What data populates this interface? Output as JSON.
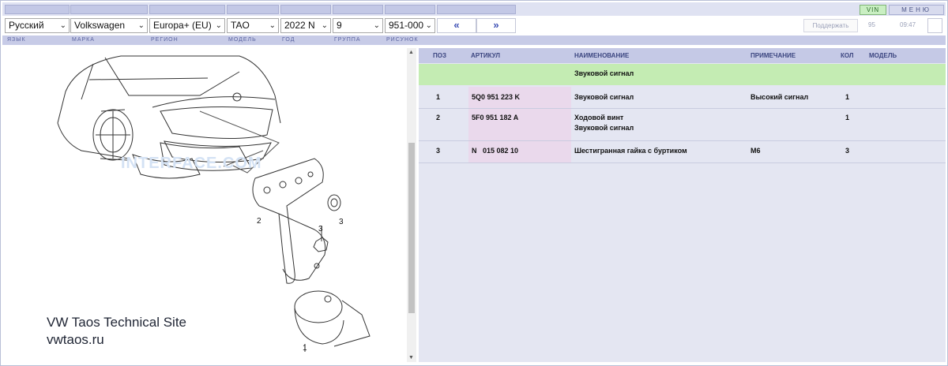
{
  "selects": {
    "language": "Русский",
    "brand": "Volkswagen",
    "region": "Europa+ (EU)",
    "model": "TAO",
    "year": "2022  N",
    "group": "9",
    "figure": "951-000"
  },
  "nav": {
    "prev": "«",
    "next": "»"
  },
  "toolbar": {
    "vin_label": "VIN",
    "menu_label": "МЕНЮ",
    "support_label": "Поддержать",
    "counter": "95",
    "time": "09:47"
  },
  "labels": {
    "language": "ЯЗЫК",
    "brand": "МАРКА",
    "region": "РЕГИОН",
    "model": "МОДЕЛЬ",
    "year": "ГОД",
    "group": "ГРУППА",
    "figure": "РИСУНОК"
  },
  "diagram": {
    "callouts": [
      "2",
      "3",
      "3",
      "1"
    ],
    "watermark": "INTERFACE.COM",
    "site_name": "VW Taos Technical Site",
    "site_url": "vwtaos.ru"
  },
  "table": {
    "headers": {
      "pos": "ПОЗ",
      "article": "АРТИКУЛ",
      "name": "НАИМЕНОВАНИЕ",
      "note": "ПРИМЕЧАНИЕ",
      "qty": "КОЛ",
      "model": "МОДЕЛЬ"
    },
    "group_title": "Звуковой сигнал",
    "rows": [
      {
        "pos": "1",
        "article": "5Q0 951 223 K",
        "name1": "Звуковой сигнал",
        "name2": "",
        "note": "Высокий сигнал",
        "qty": "1",
        "model": ""
      },
      {
        "pos": "2",
        "article": "5F0 951 182 A",
        "name1": "Ходовой винт",
        "name2": "Звуковой сигнал",
        "note": "",
        "qty": "1",
        "model": ""
      },
      {
        "pos": "3",
        "article": "N   015 082 10",
        "name1": "Шестигранная гайка с буртиком",
        "name2": "",
        "note": "M6",
        "qty": "3",
        "model": ""
      }
    ]
  },
  "colors": {
    "group_row": "#c4ecb3",
    "article_cell": "#ead9ec",
    "header": "#c5c9e6",
    "nav_accent": "#3f51b5"
  }
}
